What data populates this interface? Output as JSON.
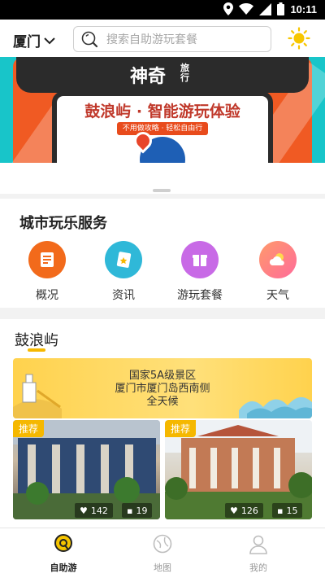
{
  "status_bar": {
    "time": "10:11"
  },
  "header": {
    "city": "厦门",
    "search_placeholder": "搜索自助游玩套餐"
  },
  "banner": {
    "brand": "神奇",
    "brand_small": "旅行",
    "title": "鼓浪屿 · 智能游玩体验",
    "tagline": "不用做攻略 · 轻松自由行"
  },
  "services": {
    "title": "城市玩乐服务",
    "items": [
      {
        "label": "概况",
        "icon": "overview-icon",
        "color": "#f26a1b"
      },
      {
        "label": "资讯",
        "icon": "news-icon",
        "color": "#2fb8d8"
      },
      {
        "label": "游玩套餐",
        "icon": "package-icon",
        "color": "#c86ae6"
      },
      {
        "label": "天气",
        "icon": "weather-icon",
        "color": "#ff7a9c"
      }
    ]
  },
  "gulangyu": {
    "title": "鼓浪屿",
    "info": [
      "国家5A级景区",
      "厦门市厦门岛西南侧",
      "全天候"
    ],
    "cards": [
      {
        "badge": "推荐",
        "likes": "142",
        "comments": "19"
      },
      {
        "badge": "推荐",
        "likes": "126",
        "comments": "15"
      }
    ]
  },
  "bottom_nav": {
    "items": [
      {
        "label": "自助游",
        "active": true
      },
      {
        "label": "地图",
        "active": false
      },
      {
        "label": "我的",
        "active": false
      }
    ]
  },
  "colors": {
    "accent": "#f5b800",
    "status_bar": "#000000"
  }
}
